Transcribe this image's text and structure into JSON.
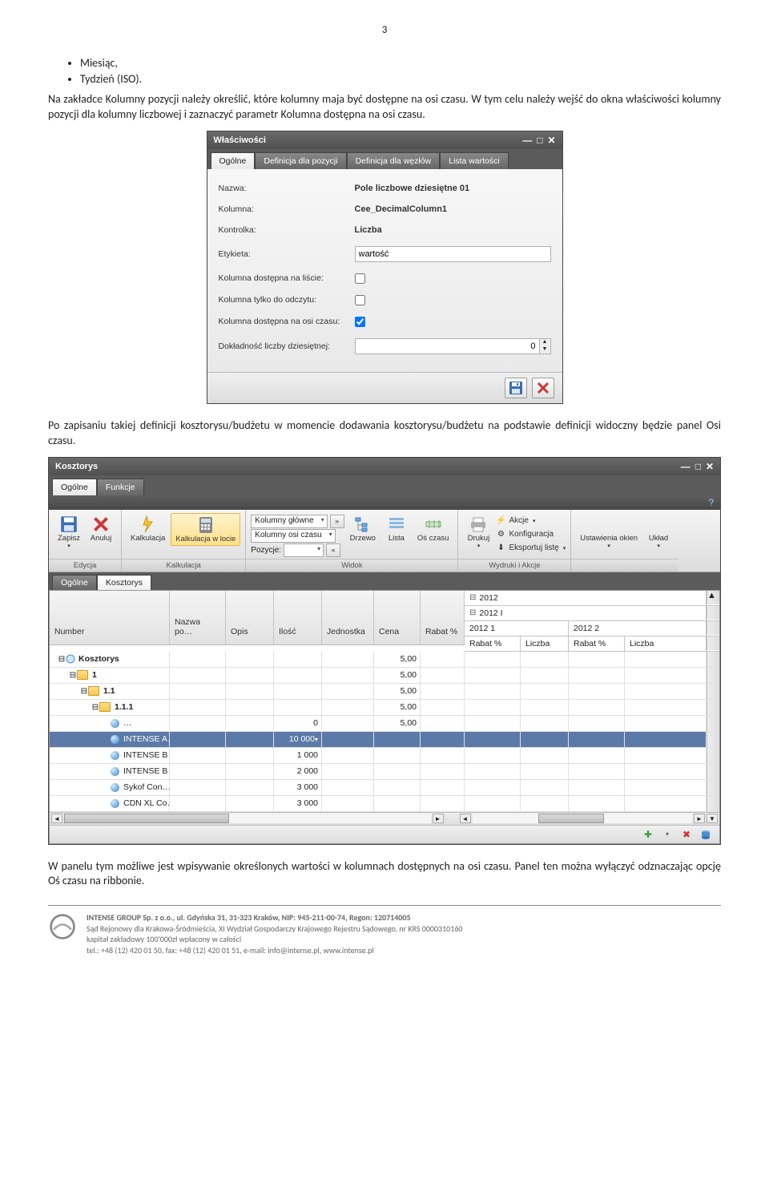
{
  "page": {
    "number": "3"
  },
  "bullets": [
    "Miesiąc,",
    "Tydzień (ISO)."
  ],
  "para1": "Na zakładce Kolumny pozycji należy określić, które kolumny maja być dostępne na osi czasu. W tym celu należy wejść do okna właściwości kolumny pozycji dla kolumny liczbowej i zaznaczyć parametr Kolumna dostępna na osi czasu.",
  "propsWin": {
    "title": "Właściwości",
    "tabs": [
      "Ogólne",
      "Definicja dla pozycji",
      "Definicja dla węzłów",
      "Lista wartości"
    ],
    "rows": {
      "nazwa_label": "Nazwa:",
      "nazwa_value": "Pole liczbowe dziesiętne 01",
      "kolumna_label": "Kolumna:",
      "kolumna_value": "Cee_DecimalColumn1",
      "kontrolka_label": "Kontrolka:",
      "kontrolka_value": "Liczba",
      "etykieta_label": "Etykieta:",
      "etykieta_value": "wartość",
      "dostLista_label": "Kolumna dostępna na liście:",
      "tylkoOdczyt_label": "Kolumna tylko do odczytu:",
      "dostOsi_label": "Kolumna dostępna na osi czasu:",
      "dokladnosc_label": "Dokładność liczby dziesiętnej:",
      "dokladnosc_value": "0"
    }
  },
  "para2": "Po zapisaniu takiej definicji kosztorysu/budżetu w momencie dodawania kosztorysu/budżetu na podstawie definicji widoczny będzie panel Osi czasu.",
  "koszWin": {
    "title": "Kosztorys",
    "topTabs": [
      "Ogólne",
      "Funkcje"
    ],
    "ribbon": {
      "zapisz": "Zapisz",
      "anuluj": "Anuluj",
      "kalkulacja": "Kalkulacja",
      "kalkLocie": "Kalkulacja w locie",
      "kolGlowne": "Kolumny główne",
      "kolOsi": "Kolumny osi czasu",
      "pozycje": "Pozycje:",
      "drzewo": "Drzewo",
      "lista": "Lista",
      "osCzasu": "Oś czasu",
      "drukuj": "Drukuj",
      "akcje": "Akcje",
      "konfig": "Konfiguracja",
      "eksport": "Eksportuj listę",
      "ustawienia": "Ustawienia okien",
      "uklad": "Układ",
      "grp_edycja": "Edycja",
      "grp_kalk": "Kalkulacja",
      "grp_widok": "Widok",
      "grp_wydruki": "Wydruki i Akcje"
    },
    "subTabs": [
      "Ogólne",
      "Kosztorys"
    ],
    "grid": {
      "cols": {
        "number": "Number",
        "nazwa": "Nazwa po…",
        "opis": "Opis",
        "ilosc": "Ilość",
        "jednostka": "Jednostka",
        "cena": "Cena",
        "rabat": "Rabat %"
      },
      "year": "2012",
      "period": "2012 I",
      "sub1": "2012 1",
      "sub2": "2012 2",
      "rrabat": "Rabat %",
      "rliczba": "Liczba",
      "rows": [
        {
          "label": "Kosztorys",
          "level": 0,
          "type": "root",
          "cena": "5,00"
        },
        {
          "label": "1",
          "level": 1,
          "type": "folder",
          "cena": "5,00"
        },
        {
          "label": "1.1",
          "level": 2,
          "type": "folder",
          "cena": "5,00"
        },
        {
          "label": "1.1.1",
          "level": 3,
          "type": "folder",
          "cena": "5,00"
        },
        {
          "label": "…",
          "level": 4,
          "type": "leaf",
          "ilosc": "0",
          "cena": "5,00"
        },
        {
          "label": "INTENSE A…",
          "level": 4,
          "type": "leaf",
          "ilosc": "10 000",
          "sel": true
        },
        {
          "label": "INTENSE B…",
          "level": 4,
          "type": "leaf",
          "ilosc": "1 000"
        },
        {
          "label": "INTENSE B…",
          "level": 4,
          "type": "leaf",
          "ilosc": "2 000"
        },
        {
          "label": "Sykof Con…",
          "level": 4,
          "type": "leaf",
          "ilosc": "3 000"
        },
        {
          "label": "CDN XL Co…",
          "level": 4,
          "type": "leaf",
          "ilosc": "3 000"
        }
      ]
    }
  },
  "para3": "W panelu tym możliwe jest wpisywanie określonych wartości w kolumnach dostępnych na osi czasu. Panel ten można wyłączyć odznaczając opcję Oś czasu na ribbonie.",
  "footer": {
    "l1": "INTENSE GROUP  Sp. z o.o., ul. Gdyńska 31, 31-323 Kraków, NIP: 945-211-00-74, Regon: 120714005",
    "l2": "Sąd Rejonowy dla Krakowa-Śródmieścia, XI Wydział Gospodarczy Krajowego Rejestru Sądowego, nr KRS 0000310160",
    "l3": "kapitał zakładowy 100'000zł wpłacony w całości",
    "l4": "tel.: +48 (12) 420 01 50, fax: +48 (12) 420 01 51, e-mail: info@intense.pl, www.intense.pl"
  }
}
